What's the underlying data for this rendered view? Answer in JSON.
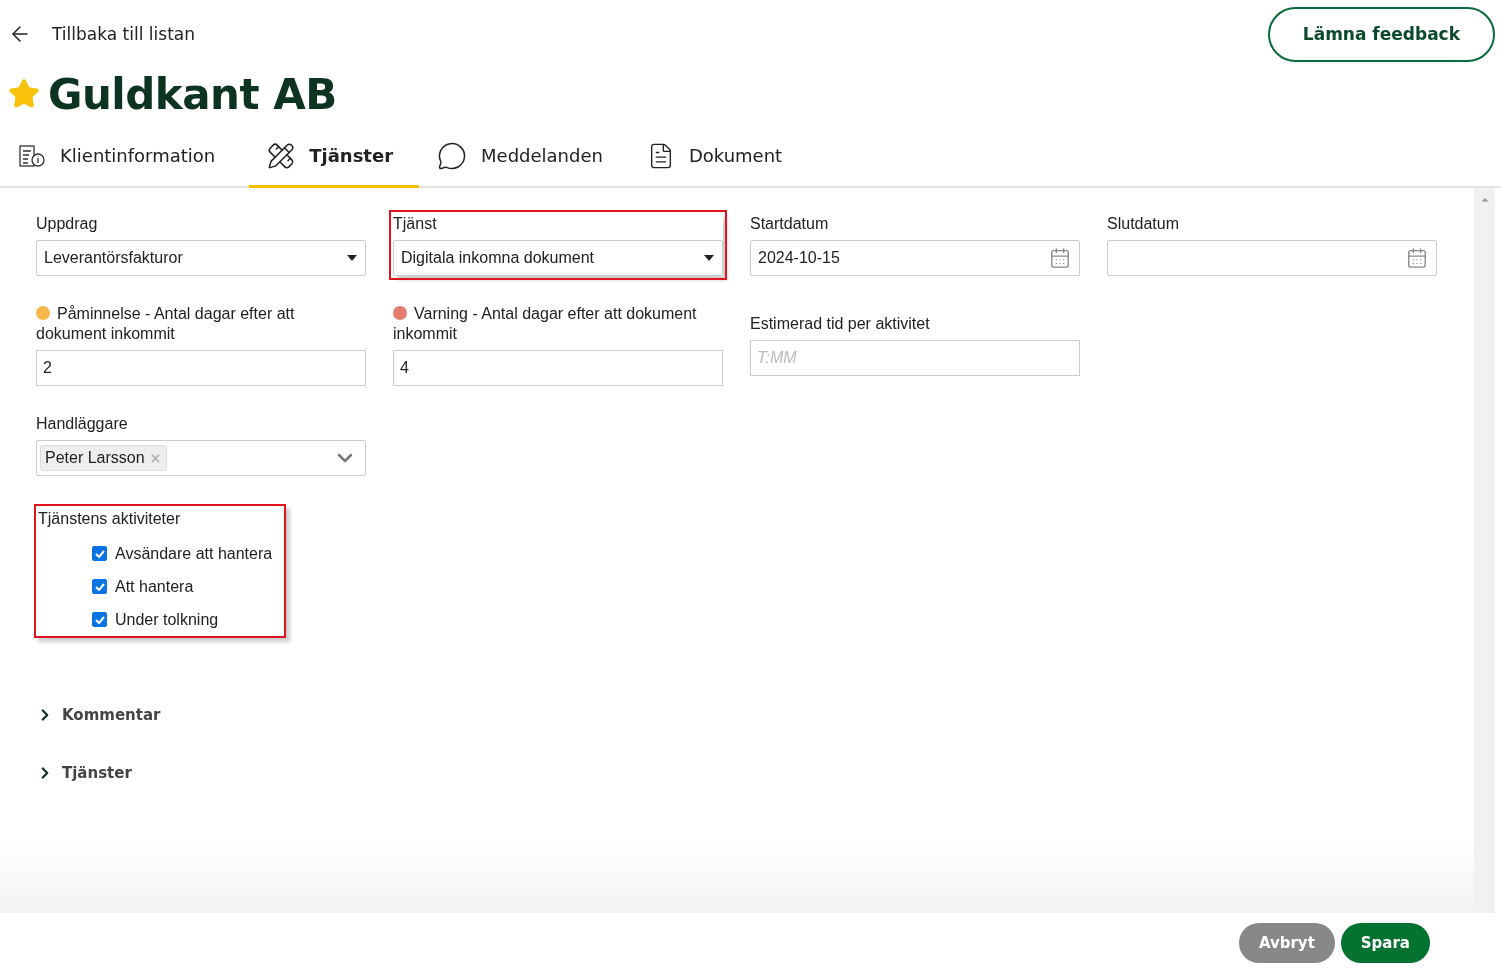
{
  "back_link": {
    "label": "Tillbaka till listan"
  },
  "feedback_button": {
    "label": "Lämna feedback"
  },
  "title": {
    "text": "Guldkant AB",
    "favorite": true
  },
  "tabs": [
    {
      "label": "Klientinformation",
      "kind": "info",
      "selected": false
    },
    {
      "label": "Tjänster",
      "kind": "services",
      "selected": true
    },
    {
      "label": "Meddelanden",
      "kind": "messages",
      "selected": false
    },
    {
      "label": "Dokument",
      "kind": "document",
      "selected": false
    }
  ],
  "form_rows": [
    [
      {
        "kind": "select",
        "label": "Uppdrag",
        "value": "Leverantörsfakturor",
        "highlighted": false
      },
      {
        "kind": "select",
        "label": "Tjänst",
        "value": "Digitala inkomna dokument",
        "highlighted": true
      },
      {
        "kind": "date",
        "label": "Startdatum",
        "value": "2024-10-15",
        "highlighted": false
      },
      {
        "kind": "date",
        "label": "Slutdatum",
        "highlighted": false
      }
    ],
    [
      {
        "kind": "text",
        "label": "Påminnelse - Antal dagar efter att dokument inkommit",
        "color": "#f7b84b",
        "value": "2",
        "highlighted": false
      },
      {
        "kind": "text",
        "label": "Varning - Antal dagar efter att dokument inkommit",
        "color": "#e57b6f",
        "value": "4",
        "highlighted": false
      },
      {
        "kind": "text",
        "label": "Estimerad tid per aktivitet",
        "placeholder": "T:MM",
        "highlighted": false
      }
    ],
    [
      {
        "kind": "multiselect",
        "label": "Handläggare",
        "tags": [
          "Peter Larsson"
        ],
        "highlighted": false
      }
    ]
  ],
  "activities": {
    "label": "Tjänstens aktiviteter",
    "highlighted": true,
    "items": [
      {
        "label": "Avsändare att hantera",
        "checked": true
      },
      {
        "label": "Att hantera",
        "checked": true
      },
      {
        "label": "Under tolkning",
        "checked": true
      }
    ]
  },
  "sections": [
    {
      "label": "Kommentar",
      "expanded": false
    },
    {
      "label": "Tjänster",
      "expanded": false
    }
  ],
  "footer_buttons": [
    {
      "label": "Avbryt",
      "kind": "secondary"
    },
    {
      "label": "Spara",
      "kind": "primary"
    }
  ]
}
